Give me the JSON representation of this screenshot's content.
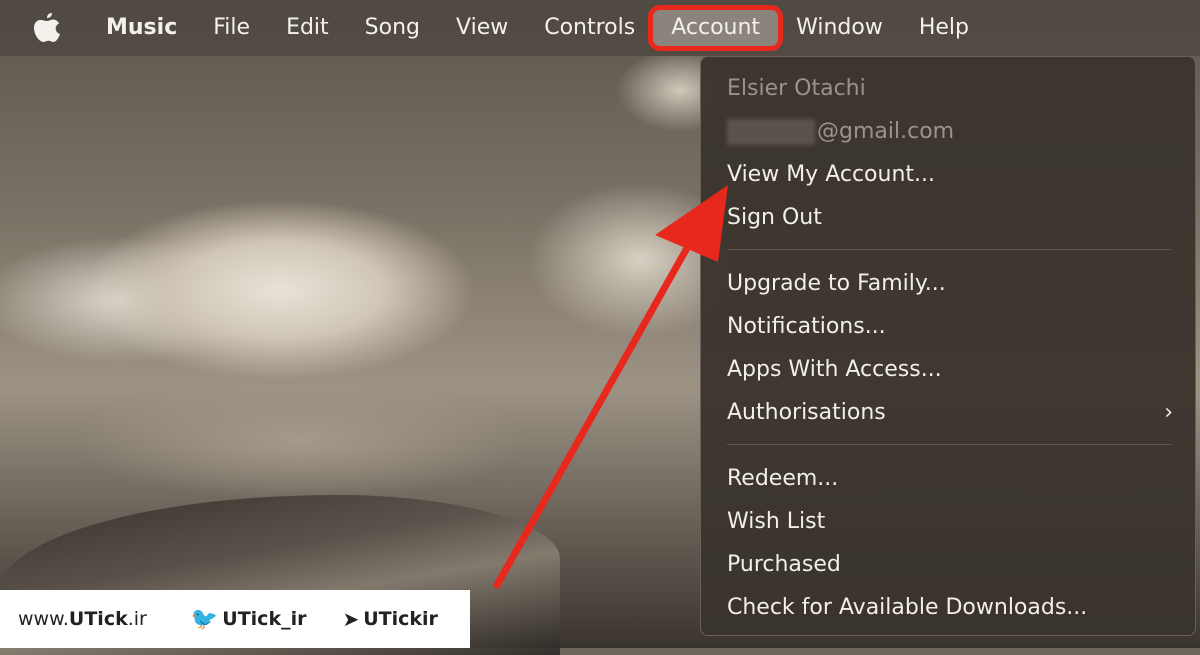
{
  "menubar": {
    "apple_icon": "apple-logo-icon",
    "items": [
      "Music",
      "File",
      "Edit",
      "Song",
      "View",
      "Controls",
      "Account",
      "Window",
      "Help"
    ]
  },
  "account_menu": {
    "user_name": "Elsier Otachi",
    "email": "@gmail.com",
    "group1": [
      "View My Account...",
      "Sign Out"
    ],
    "group2": [
      "Upgrade to Family...",
      "Notifications...",
      "Apps With Access...",
      "Authorisations"
    ],
    "group3": [
      "Redeem...",
      "Wish List",
      "Purchased",
      "Check for Available Downloads..."
    ]
  },
  "annotation": {
    "highlight_color": "#e8281d",
    "arrow_color": "#e8281d"
  },
  "watermark": {
    "site_prefix": "www.",
    "site_name": "UTick",
    "site_suffix": ".ir",
    "twitter": "UTick_ir",
    "telegram": "UTickir"
  }
}
